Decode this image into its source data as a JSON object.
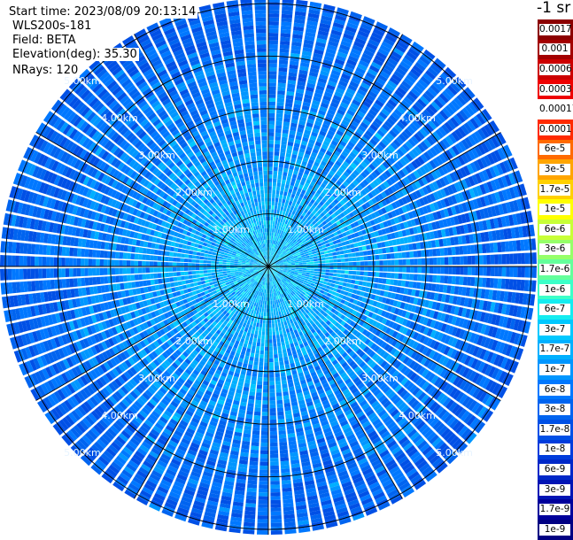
{
  "header": {
    "start_time": "Start time: 2023/08/09 20:13:14",
    "instrument": "WLS200s-181",
    "field": "Field: BETA",
    "elevation": "Elevation(deg): 35.30",
    "nrays": "NRays: 120"
  },
  "colorbar": {
    "unit": "-1 sr",
    "labels": [
      "0.0017",
      "0.001",
      "0.0006",
      "0.0003",
      "0.00017",
      "0.0001",
      "6e-5",
      "3e-5",
      "1.7e-5",
      "1e-5",
      "6e-6",
      "3e-6",
      "1.7e-6",
      "1e-6",
      "6e-7",
      "3e-7",
      "1.7e-7",
      "1e-7",
      "6e-8",
      "3e-8",
      "1.7e-8",
      "1e-8",
      "6e-9",
      "3e-9",
      "1.7e-9",
      "1e-9"
    ],
    "colors": [
      "#8b0000",
      "#a30000",
      "#cc0000",
      "#ee0000",
      "#ffffff",
      "#ff2a00",
      "#ff6a00",
      "#ffa500",
      "#ffd000",
      "#ffff00",
      "#c8ff37",
      "#96ff69",
      "#64ff9b",
      "#3cffc8",
      "#14ecf0",
      "#00c8ff",
      "#00b0ff",
      "#0096ff",
      "#0078ff",
      "#0064f0",
      "#0050e6",
      "#003cdc",
      "#0028c8",
      "#0014b4",
      "#00009b",
      "#000082"
    ]
  },
  "chart_data": {
    "type": "ppi-polar",
    "field": "BETA",
    "elevation_deg": 35.3,
    "n_rays": 120,
    "range_rings_km": [
      1.0,
      2.0,
      3.0,
      4.0,
      5.0
    ],
    "ring_labels": [
      "1.00km",
      "2.00km",
      "3.00km",
      "4.00km",
      "5.00km"
    ],
    "max_range_km": 5.1,
    "azimuth_spokes_deg": [
      0,
      30,
      60,
      90,
      120,
      150,
      180,
      210,
      240,
      270,
      300,
      330
    ],
    "scale": "log",
    "dominant_range": [
      1e-08,
      1.7e-07
    ]
  }
}
